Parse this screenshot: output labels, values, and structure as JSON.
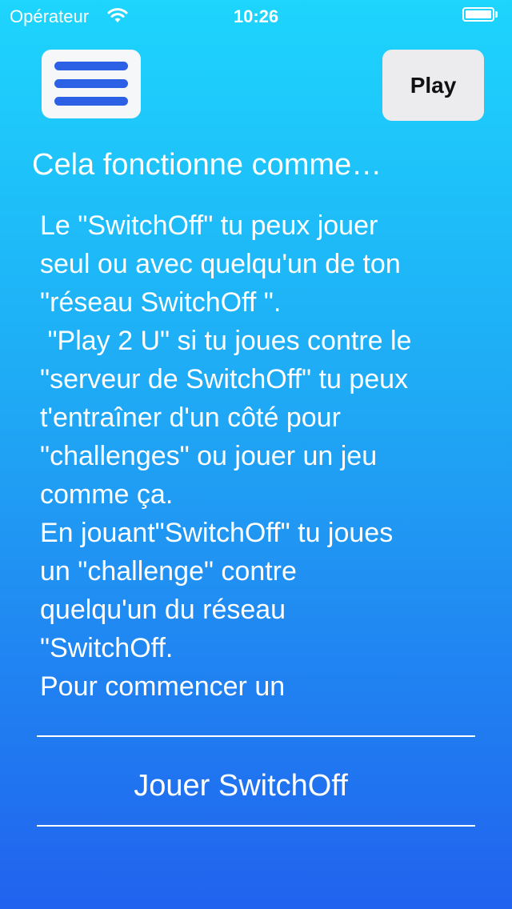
{
  "status_bar": {
    "carrier": "Opérateur",
    "time": "10:26",
    "wifi_icon": "wifi-icon",
    "battery_icon": "battery-icon",
    "battery_level": 1.0
  },
  "header": {
    "menu_icon": "hamburger-menu-icon",
    "play_label": "Play"
  },
  "content": {
    "title": "Cela fonctionne comme…",
    "lines": [
      "Le \"SwitchOff\" tu peux jouer",
      "seul ou avec quelqu'un de ton",
      "\"réseau SwitchOff \".",
      " \"Play 2 U\" si tu joues contre le",
      "\"serveur de SwitchOff\" tu peux",
      "t'entraîner d'un côté pour",
      "\"challenges\" ou jouer un jeu",
      "comme ça.",
      "En jouant\"SwitchOff\" tu joues",
      "un \"challenge\" contre",
      "quelqu'un du réseau",
      "\"SwitchOff.",
      "Pour commencer un"
    ]
  },
  "action": {
    "label": "Jouer SwitchOff"
  },
  "colors": {
    "gradient_top": "#1dd5fd",
    "gradient_bottom": "#2162ee",
    "menu_bar": "#2c61e6",
    "button_bg": "#ececef"
  }
}
